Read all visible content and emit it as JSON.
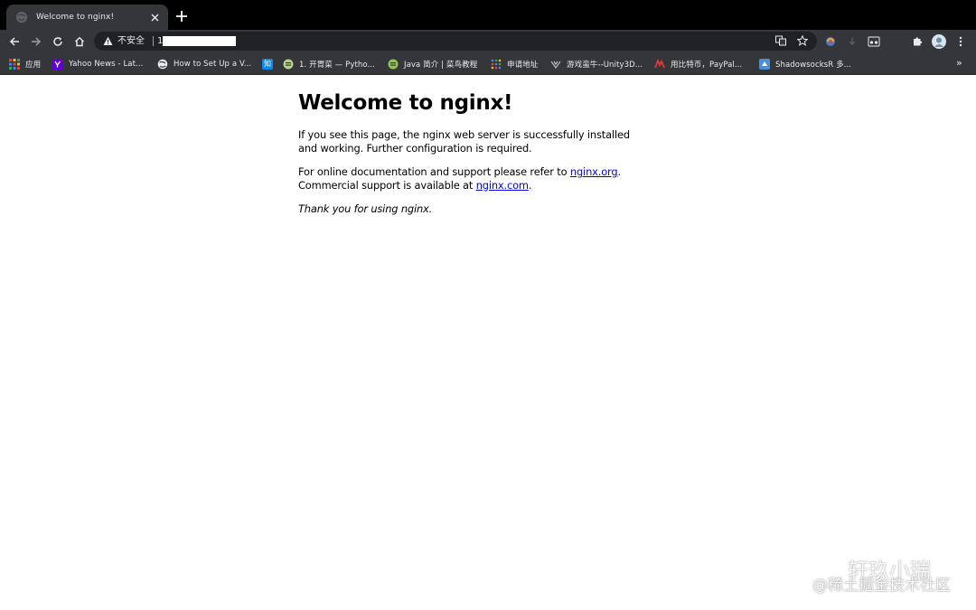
{
  "browser": {
    "tab": {
      "title": "Welcome to nginx!"
    },
    "omnibox": {
      "security_label": "不安全",
      "url_prefix": "1"
    },
    "bookmarks": [
      {
        "label": "应用",
        "icon": "apps-grid-icon"
      },
      {
        "label": "Yahoo News - Lat...",
        "icon": "yahoo-icon"
      },
      {
        "label": "How to Set Up a V...",
        "icon": "globe-icon"
      },
      {
        "label": "",
        "icon": "zhihu-icon"
      },
      {
        "label": "1. 开胃菜 — Pytho...",
        "icon": "site-icon"
      },
      {
        "label": "Java 简介 | 菜鸟教程",
        "icon": "runoob-icon"
      },
      {
        "label": "申请地址",
        "icon": "dots-grid-icon"
      },
      {
        "label": "游戏蛮牛--Unity3D...",
        "icon": "unity-icon"
      },
      {
        "label": "用比特币，PayPal...",
        "icon": "red-logo-icon"
      },
      {
        "label": "ShadowsocksR 多...",
        "icon": "ssr-icon"
      }
    ],
    "zhihu_glyph": "知",
    "more_glyph": "»"
  },
  "page": {
    "heading": "Welcome to nginx!",
    "para1": "If you see this page, the nginx web server is successfully installed and working. Further configuration is required.",
    "para2_before": "For online documentation and support please refer to ",
    "link1": "nginx.org",
    "para2_mid": ".",
    "para2_line2": "Commercial support is available at ",
    "link2": "nginx.com",
    "para2_end": ".",
    "para3": "Thank you for using nginx."
  },
  "watermark": {
    "author": "轩玖小瑞",
    "site": "@稀土掘金技术社区"
  },
  "colors": {
    "tabstrip": "#000000",
    "toolbar": "#35363a",
    "omnibox": "#202124",
    "link": "#0000ee"
  }
}
